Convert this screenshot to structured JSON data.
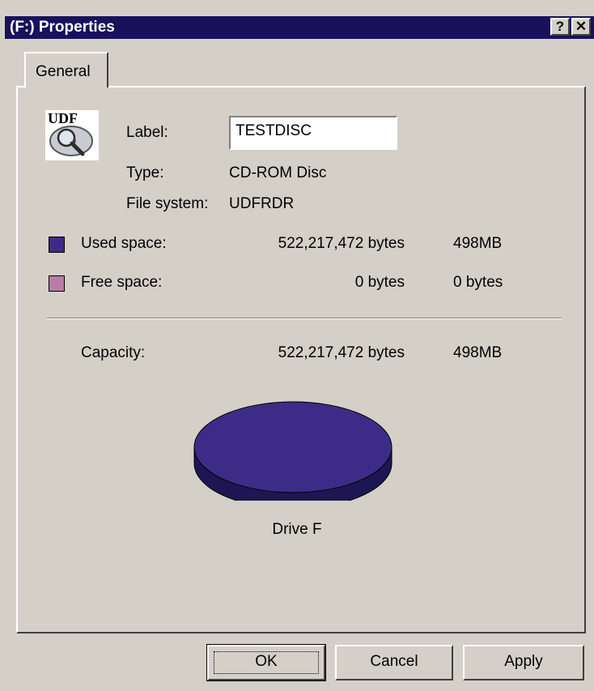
{
  "window": {
    "title": "(F:) Properties",
    "help_label": "?",
    "close_label": "✕"
  },
  "tabs": [
    {
      "label": "General"
    }
  ],
  "drive": {
    "icon_text": "UDF",
    "label_caption": "Label:",
    "label_value": "TESTDISC",
    "type_caption": "Type:",
    "type_value": "CD-ROM Disc",
    "fs_caption": "File system:",
    "fs_value": "UDFRDR"
  },
  "space": {
    "used": {
      "caption": "Used space:",
      "bytes": "522,217,472 bytes",
      "short": "498MB",
      "color": "#3d2c87"
    },
    "free": {
      "caption": "Free space:",
      "bytes": "0 bytes",
      "short": "0 bytes",
      "color": "#b87ca7"
    },
    "capacity": {
      "caption": "Capacity:",
      "bytes": "522,217,472 bytes",
      "short": "498MB"
    }
  },
  "chart_data": {
    "type": "pie",
    "categories": [
      "Used space",
      "Free space"
    ],
    "values": [
      522217472,
      0
    ],
    "colors": [
      "#3d2c87",
      "#b87ca7"
    ],
    "title": "Drive F"
  },
  "buttons": {
    "ok": "OK",
    "cancel": "Cancel",
    "apply": "Apply"
  }
}
